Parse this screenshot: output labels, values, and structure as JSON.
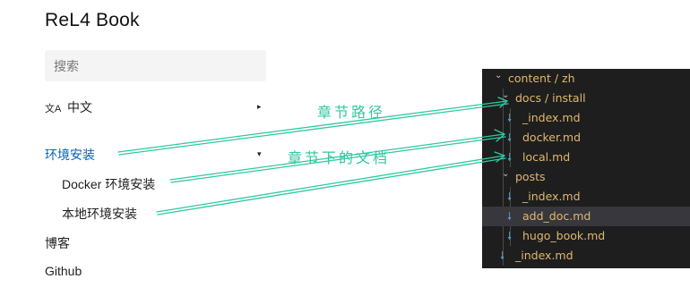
{
  "sidebar": {
    "title": "ReL4 Book",
    "search_placeholder": "搜索",
    "lang_icon": "文A",
    "language_label": "中文",
    "items": [
      {
        "label": "环境安装",
        "active": true
      },
      {
        "label": "Docker 环境安装"
      },
      {
        "label": "本地环境安装"
      },
      {
        "label": "博客"
      },
      {
        "label": "Github"
      }
    ],
    "caret": "▸",
    "caret_open": "▾"
  },
  "tree": {
    "rows": [
      {
        "label": "content / zh",
        "icon": "chevron-down"
      },
      {
        "label": "docs / install",
        "icon": "chevron-down"
      },
      {
        "label": "_index.md",
        "icon": "markdown"
      },
      {
        "label": "docker.md",
        "icon": "markdown"
      },
      {
        "label": "local.md",
        "icon": "markdown"
      },
      {
        "label": "posts",
        "icon": "chevron-down"
      },
      {
        "label": "_index.md",
        "icon": "markdown"
      },
      {
        "label": "add_doc.md",
        "icon": "markdown",
        "selected": true
      },
      {
        "label": "hugo_book.md",
        "icon": "markdown"
      },
      {
        "label": "_index.md",
        "icon": "markdown"
      }
    ],
    "chevron_glyph": "⌄",
    "md_glyph": "🠗"
  },
  "annotations": {
    "chapter_path": "章节路径",
    "chapter_docs": "章节下的文档",
    "color": "#2fc9a1"
  }
}
